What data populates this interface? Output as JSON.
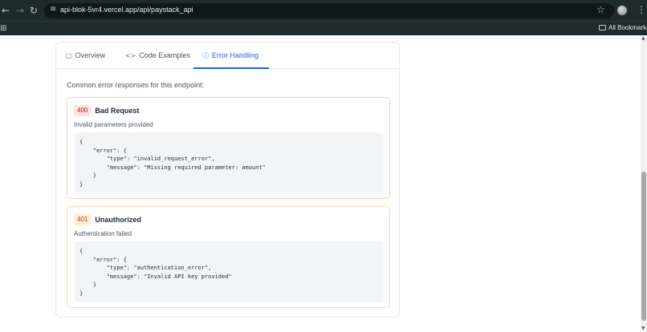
{
  "browser": {
    "url": "api-blok-5vr4.vercel.app/api/paystack_api",
    "bookmarks_label": "All Bookmarks",
    "icons": {
      "back": "←",
      "forward": "→",
      "reload": "↻",
      "site_settings": "≡",
      "star": "☆",
      "menu": "⋮",
      "apps": "⊞"
    }
  },
  "tabs": [
    {
      "icon": "book-icon",
      "glyph": "□",
      "label": "Overview",
      "active": false
    },
    {
      "icon": "code-icon",
      "glyph": "<>",
      "label": "Code Examples",
      "active": false
    },
    {
      "icon": "alert-circle-icon",
      "glyph": "ⓘ",
      "label": "Error Handling",
      "active": true
    }
  ],
  "intro": "Common error responses for this endpoint:",
  "errors": [
    {
      "code": "400",
      "title": "Bad Request",
      "description": "Invalid parameters provided",
      "body": "{\n    \"error\": {\n        \"type\": \"invalid_request_error\",\n        \"message\": \"Missing required parameter: amount\"\n    }\n}",
      "accent": "#b91c1c"
    },
    {
      "code": "401",
      "title": "Unauthorized",
      "description": "Authentication failed",
      "body": "{\n    \"error\": {\n        \"type\": \"authentication_error\",\n        \"message\": \"Invalid API key provided\"\n    }\n}",
      "accent": "#c2410c"
    }
  ],
  "colors": {
    "active_tab": "#2563eb",
    "chrome_bg": "#1f2a2e"
  }
}
